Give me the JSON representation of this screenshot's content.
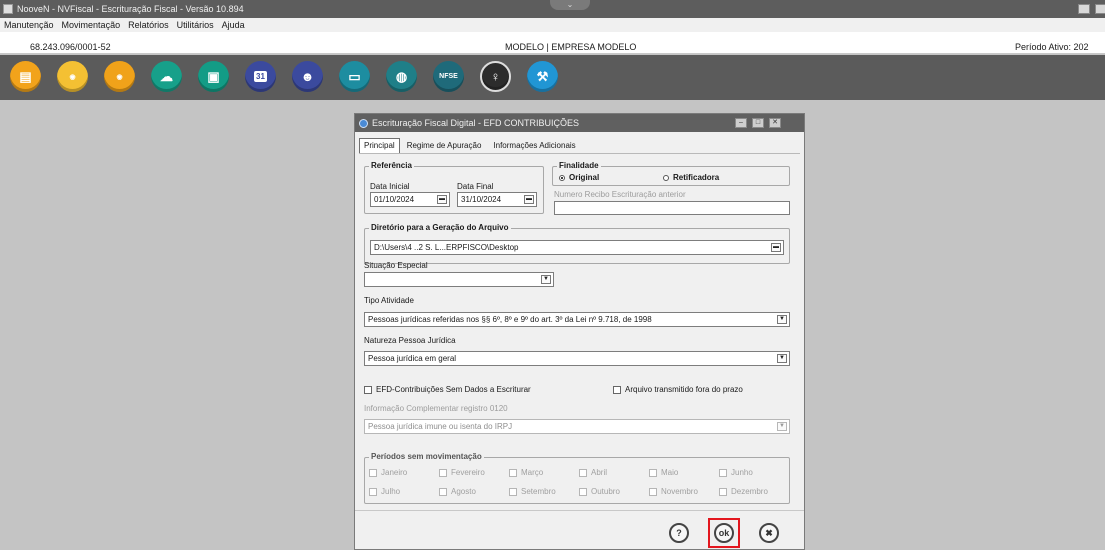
{
  "window": {
    "title": "NooveN - NVFiscal - Escrituração Fiscal - Versão 10.894"
  },
  "menu": {
    "items": [
      "Manutenção",
      "Movimentação",
      "Relatórios",
      "Utilitários",
      "Ajuda"
    ]
  },
  "infobar": {
    "cnpj": "68.243.096/0001-52",
    "company": "MODELO | EMPRESA MODELO",
    "period": "Período Ativo: 202"
  },
  "toolbar": {
    "icons": [
      {
        "name": "book-icon",
        "color": "#f2a31b"
      },
      {
        "name": "coins-icon",
        "color": "#f4c033"
      },
      {
        "name": "coins-2-icon",
        "color": "#f0a21a"
      },
      {
        "name": "cloud-icon",
        "color": "#17a08a"
      },
      {
        "name": "clipboard-icon",
        "color": "#139c86"
      },
      {
        "name": "calendar-icon",
        "color": "#3b4a9e"
      },
      {
        "name": "people-icon",
        "color": "#3b4a9e"
      },
      {
        "name": "computer-icon",
        "color": "#1d8da0"
      },
      {
        "name": "database-icon",
        "color": "#1f7f88"
      },
      {
        "name": "nfse-icon",
        "color": "#1f6a7a"
      },
      {
        "name": "support-avatar-icon",
        "color": "#2c2c2c"
      },
      {
        "name": "gavel-icon",
        "color": "#2196d4"
      }
    ],
    "calendar_text": "31",
    "nfse_text": "NFSE"
  },
  "dialog": {
    "title": "Escrituração Fiscal Digital - EFD CONTRIBUIÇÕES",
    "tabs": [
      "Principal",
      "Regime de Apuração",
      "Informações Adicionais"
    ],
    "referencia": {
      "legend": "Referência",
      "data_inicial_label": "Data Inicial",
      "data_inicial": "01/10/2024",
      "data_final_label": "Data Final",
      "data_final": "31/10/2024"
    },
    "finalidade": {
      "legend": "Finalidade",
      "original": "Original",
      "retificadora": "Retificadora",
      "recibo_label": "Numero Recibo Escrituração anterior",
      "recibo_value": ""
    },
    "diretorio": {
      "legend": "Diretório para a Geração do Arquivo",
      "value": "D:\\Users\\4 ..2 S. L...ERPFISCO\\Desktop"
    },
    "situacao": {
      "label": "Situação Especial",
      "value": ""
    },
    "tipo_atividade": {
      "label": "Tipo Atividade",
      "value": "Pessoas jurídicas referidas nos §§ 6º, 8º e 9º do art. 3º da Lei nº 9.718, de 1998"
    },
    "natureza": {
      "label": "Natureza Pessoa Jurídica",
      "value": "Pessoa jurídica em geral"
    },
    "checks": {
      "sem_dados": "EFD-Contribuições Sem Dados a Escriturar",
      "fora_prazo": "Arquivo transmitido fora do prazo"
    },
    "complementar": {
      "label": "Informação Complementar registro 0120",
      "value": "Pessoa jurídica imune ou isenta do IRPJ"
    },
    "periodos": {
      "legend": "Períodos sem movimentação",
      "months": [
        "Janeiro",
        "Fevereiro",
        "Março",
        "Abril",
        "Maio",
        "Junho",
        "Julho",
        "Agosto",
        "Setembro",
        "Outubro",
        "Novembro",
        "Dezembro"
      ]
    },
    "buttons": {
      "help": "?",
      "ok": "ok",
      "cancel": "✖"
    }
  }
}
